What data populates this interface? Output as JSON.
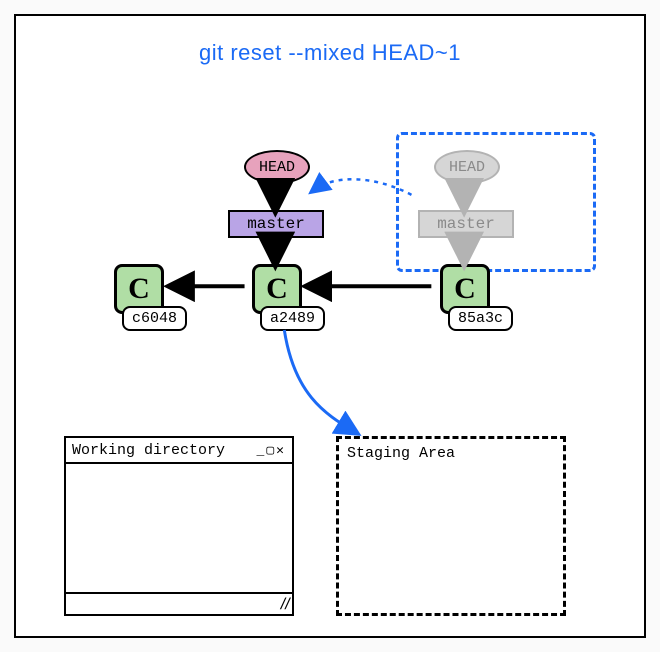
{
  "title": "git reset --mixed HEAD~1",
  "head": {
    "label": "HEAD"
  },
  "branch": {
    "label": "master"
  },
  "ghost": {
    "head_label": "HEAD",
    "branch_label": "master"
  },
  "commits": {
    "c0": {
      "glyph": "C",
      "hash": "c6048"
    },
    "c1": {
      "glyph": "C",
      "hash": "a2489"
    },
    "c2": {
      "glyph": "C",
      "hash": "85a3c"
    }
  },
  "working_dir": {
    "title": "Working directory",
    "controls": "_▢✕"
  },
  "staging": {
    "title": "Staging Area"
  }
}
